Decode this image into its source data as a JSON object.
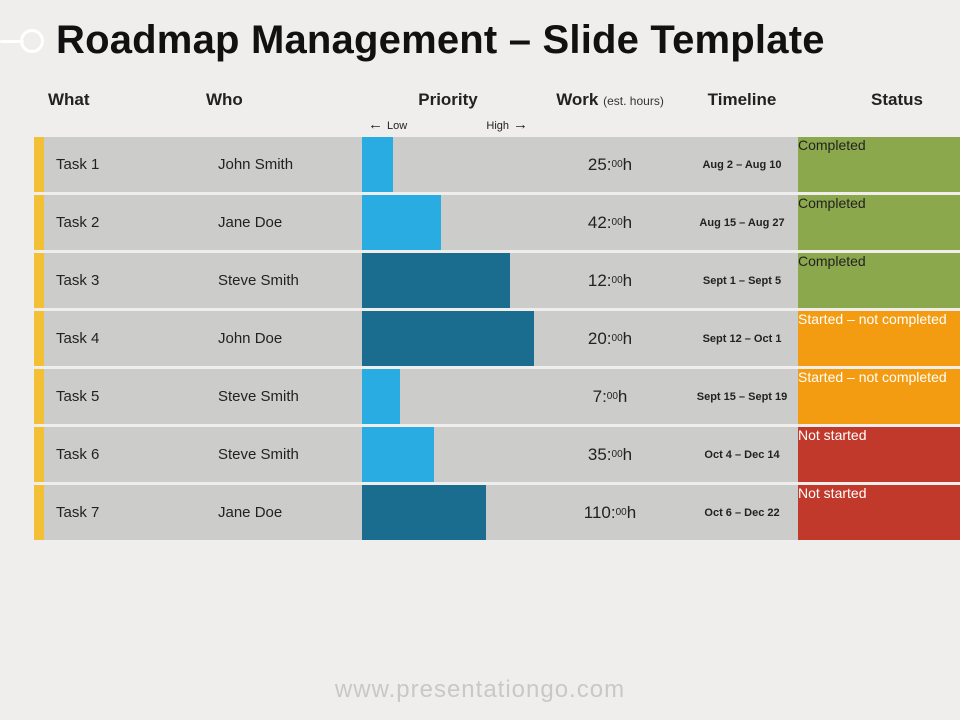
{
  "title": "Roadmap Management – Slide Template",
  "headers": {
    "what": "What",
    "who": "Who",
    "priority": "Priority",
    "work": "Work",
    "work_sub": "(est. hours)",
    "timeline": "Timeline",
    "status": "Status"
  },
  "priority_scale": {
    "low": "Low",
    "high": "High"
  },
  "status_labels": {
    "completed": "Completed",
    "started": "Started – not completed",
    "not": "Not started"
  },
  "rows": [
    {
      "what": "Task 1",
      "who": "John Smith",
      "priority_pct": 18,
      "priority_tone": "light",
      "work_h": 25,
      "work_m": "00",
      "timeline": "Aug 2 – Aug 10",
      "status": "completed"
    },
    {
      "what": "Task 2",
      "who": "Jane Doe",
      "priority_pct": 46,
      "priority_tone": "light",
      "work_h": 42,
      "work_m": "00",
      "timeline": "Aug 15 – Aug 27",
      "status": "completed"
    },
    {
      "what": "Task 3",
      "who": "Steve Smith",
      "priority_pct": 86,
      "priority_tone": "dark",
      "work_h": 12,
      "work_m": "00",
      "timeline": "Sept 1 – Sept 5",
      "status": "completed"
    },
    {
      "what": "Task 4",
      "who": "John Doe",
      "priority_pct": 100,
      "priority_tone": "dark",
      "work_h": 20,
      "work_m": "00",
      "timeline": "Sept 12 – Oct 1",
      "status": "started"
    },
    {
      "what": "Task 5",
      "who": "Steve Smith",
      "priority_pct": 22,
      "priority_tone": "light",
      "work_h": 7,
      "work_m": "00",
      "timeline": "Sept 15 – Sept 19",
      "status": "started"
    },
    {
      "what": "Task 6",
      "who": "Steve Smith",
      "priority_pct": 42,
      "priority_tone": "light",
      "work_h": 35,
      "work_m": "00",
      "timeline": "Oct 4 – Dec 14",
      "status": "not"
    },
    {
      "what": "Task 7",
      "who": "Jane Doe",
      "priority_pct": 72,
      "priority_tone": "dark",
      "work_h": 110,
      "work_m": "00",
      "timeline": "Oct 6 – Dec 22",
      "status": "not"
    }
  ],
  "footer": "www.presentationgo.com",
  "chart_data": {
    "type": "table",
    "title": "Roadmap Management – Slide Template",
    "columns": [
      "What",
      "Who",
      "Priority (0-100)",
      "Work (est. hours)",
      "Timeline",
      "Status"
    ],
    "priority_axis": {
      "low": "Low",
      "high": "High",
      "range": [
        0,
        100
      ]
    },
    "rows": [
      [
        "Task 1",
        "John Smith",
        18,
        25,
        "Aug 2 – Aug 10",
        "Completed"
      ],
      [
        "Task 2",
        "Jane Doe",
        46,
        42,
        "Aug 15 – Aug 27",
        "Completed"
      ],
      [
        "Task 3",
        "Steve Smith",
        86,
        12,
        "Sept 1 – Sept 5",
        "Completed"
      ],
      [
        "Task 4",
        "John Doe",
        100,
        20,
        "Sept 12 – Oct 1",
        "Started – not completed"
      ],
      [
        "Task 5",
        "Steve Smith",
        22,
        7,
        "Sept 15 – Sept 19",
        "Started – not completed"
      ],
      [
        "Task 6",
        "Steve Smith",
        42,
        35,
        "Oct 4 – Dec 14",
        "Not started"
      ],
      [
        "Task 7",
        "Jane Doe",
        72,
        110,
        "Oct 6 – Dec 22",
        "Not started"
      ]
    ]
  }
}
